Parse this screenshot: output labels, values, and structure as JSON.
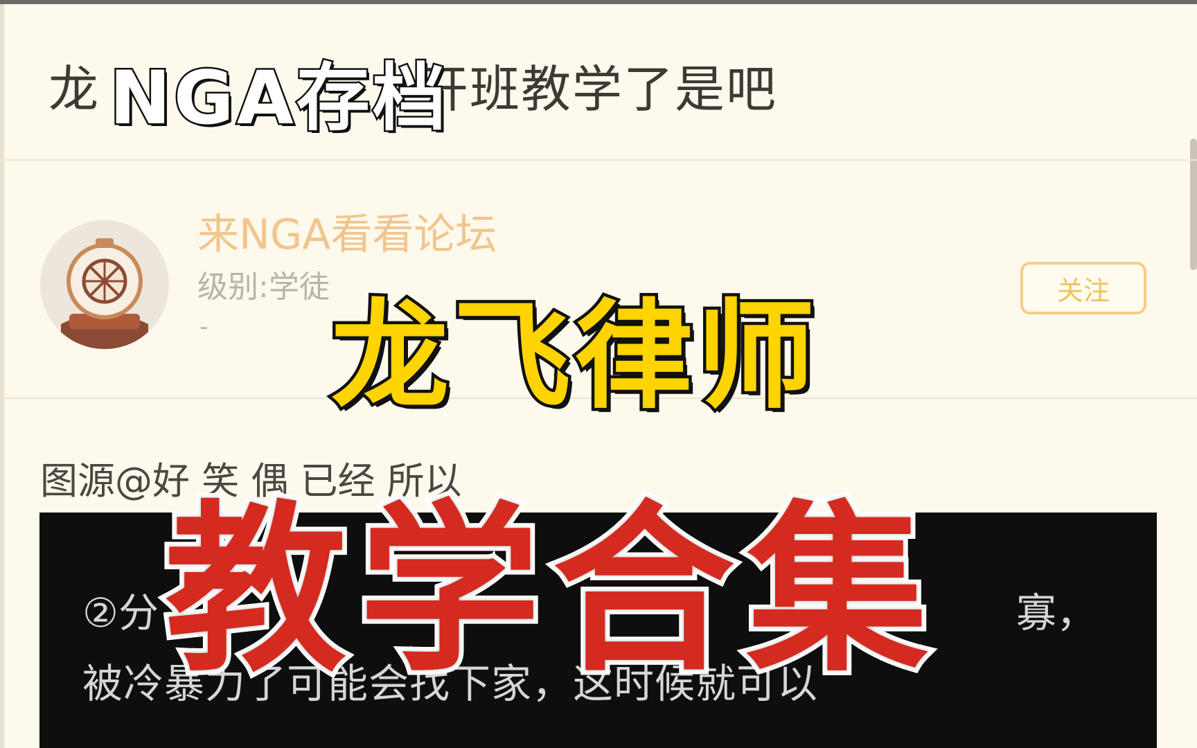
{
  "thread": {
    "title_visible_start": "龙",
    "title_visible_end": "开班教学了是吧"
  },
  "author": {
    "name": "来NGA看看论坛",
    "level": "级别:学徒",
    "extra": "-"
  },
  "follow_button": {
    "label": "关注"
  },
  "post": {
    "text": "图源@好 笑 偶 已经 所以"
  },
  "quote": {
    "line1": "②分",
    "line1_end": "寡，",
    "line2": "被冷暴力了可能会找下家，这时候就可以"
  },
  "overlay": {
    "archive": "NGA存档",
    "name": "龙飞律师",
    "collection": "教学合集"
  },
  "colors": {
    "page_bg": "#fdf9ec",
    "username": "#f1c58e",
    "follow_border": "#f2cf85",
    "overlay_yellow": "#ffd400",
    "overlay_red": "#d42a20"
  }
}
